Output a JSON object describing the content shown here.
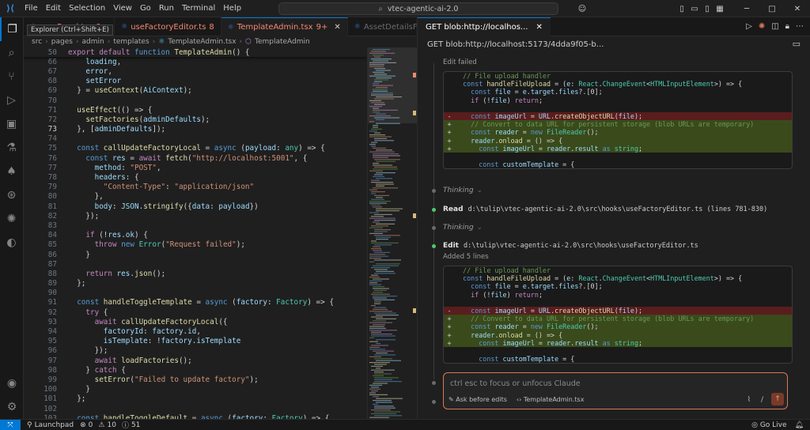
{
  "titlebar": {
    "menu": [
      "File",
      "Edit",
      "Selection",
      "View",
      "Go",
      "Run",
      "Terminal",
      "Help"
    ],
    "command_center": "vtec-agentic-ai-2.0"
  },
  "tooltip": "Explorer (Ctrl+Shift+E)",
  "tabs": [
    {
      "label": "cessPanel.tsx",
      "badge": "9+",
      "style": "red"
    },
    {
      "label": "useFactoryEditor.ts",
      "badge": "8",
      "style": "red"
    },
    {
      "label": "TemplateAdmin.tsx",
      "badge": "9+",
      "style": "active"
    },
    {
      "label": "AssetDetailsF",
      "badge": "",
      "style": "muted"
    }
  ],
  "breadcrumb": [
    "src",
    "pages",
    "admin",
    "templates",
    "TemplateAdmin.tsx",
    "TemplateAdmin"
  ],
  "editor": {
    "current_line": "73",
    "lines": [
      {
        "n": "50",
        "t": [
          [
            "kw2",
            "export "
          ],
          [
            "kw2",
            "default "
          ],
          [
            "kw",
            "function "
          ],
          [
            "fn",
            "TemplateAdmin"
          ],
          [
            "code",
            "() {"
          ]
        ],
        "sticky": true
      },
      {
        "n": "66",
        "t": [
          [
            "code",
            "    "
          ],
          [
            "var",
            "loading"
          ],
          [
            "code",
            ","
          ]
        ]
      },
      {
        "n": "67",
        "t": [
          [
            "code",
            "    "
          ],
          [
            "var",
            "error"
          ],
          [
            "code",
            ","
          ]
        ]
      },
      {
        "n": "68",
        "t": [
          [
            "code",
            "    "
          ],
          [
            "var",
            "setError"
          ]
        ]
      },
      {
        "n": "69",
        "t": [
          [
            "code",
            "  } = "
          ],
          [
            "fn",
            "useContext"
          ],
          [
            "code",
            "("
          ],
          [
            "var",
            "AiContext"
          ],
          [
            "code",
            ");"
          ]
        ]
      },
      {
        "n": "70",
        "t": []
      },
      {
        "n": "71",
        "t": [
          [
            "code",
            "  "
          ],
          [
            "fn",
            "useEffect"
          ],
          [
            "code",
            "(() => {"
          ]
        ]
      },
      {
        "n": "72",
        "t": [
          [
            "code",
            "    "
          ],
          [
            "fn",
            "setFactories"
          ],
          [
            "code",
            "("
          ],
          [
            "var",
            "adminDefaults"
          ],
          [
            "code",
            ");"
          ]
        ]
      },
      {
        "n": "73",
        "t": [
          [
            "code",
            "  }, ["
          ],
          [
            "var",
            "adminDefaults"
          ],
          [
            "code",
            "]);"
          ]
        ]
      },
      {
        "n": "74",
        "t": []
      },
      {
        "n": "75",
        "t": [
          [
            "code",
            "  "
          ],
          [
            "kw",
            "const "
          ],
          [
            "fn",
            "callUpdateFactoryLocal"
          ],
          [
            "code",
            " = "
          ],
          [
            "kw",
            "async "
          ],
          [
            "code",
            "("
          ],
          [
            "var",
            "payload"
          ],
          [
            "code",
            ": "
          ],
          [
            "type",
            "any"
          ],
          [
            "code",
            ") => {"
          ]
        ]
      },
      {
        "n": "76",
        "t": [
          [
            "code",
            "    "
          ],
          [
            "kw",
            "const "
          ],
          [
            "var",
            "res"
          ],
          [
            "code",
            " = "
          ],
          [
            "kw2",
            "await "
          ],
          [
            "fn",
            "fetch"
          ],
          [
            "code",
            "("
          ],
          [
            "str",
            "\"http://localhost:5001\""
          ],
          [
            "code",
            ", {"
          ]
        ]
      },
      {
        "n": "77",
        "t": [
          [
            "code",
            "      "
          ],
          [
            "var",
            "method"
          ],
          [
            "code",
            ": "
          ],
          [
            "str",
            "\"POST\""
          ],
          [
            "code",
            ","
          ]
        ]
      },
      {
        "n": "78",
        "t": [
          [
            "code",
            "      "
          ],
          [
            "var",
            "headers"
          ],
          [
            "code",
            ": {"
          ]
        ]
      },
      {
        "n": "79",
        "t": [
          [
            "code",
            "        "
          ],
          [
            "str",
            "\"Content-Type\""
          ],
          [
            "code",
            ": "
          ],
          [
            "str",
            "\"application/json\""
          ]
        ]
      },
      {
        "n": "80",
        "t": [
          [
            "code",
            "      },"
          ]
        ]
      },
      {
        "n": "81",
        "t": [
          [
            "code",
            "      "
          ],
          [
            "var",
            "body"
          ],
          [
            "code",
            ": "
          ],
          [
            "var",
            "JSON"
          ],
          [
            "code",
            "."
          ],
          [
            "fn",
            "stringify"
          ],
          [
            "code",
            "({"
          ],
          [
            "var",
            "data"
          ],
          [
            "code",
            ": "
          ],
          [
            "var",
            "payload"
          ],
          [
            "code",
            "})"
          ]
        ]
      },
      {
        "n": "82",
        "t": [
          [
            "code",
            "    });"
          ]
        ]
      },
      {
        "n": "83",
        "t": []
      },
      {
        "n": "84",
        "t": [
          [
            "code",
            "    "
          ],
          [
            "kw2",
            "if "
          ],
          [
            "code",
            "(!"
          ],
          [
            "var",
            "res"
          ],
          [
            "code",
            "."
          ],
          [
            "var",
            "ok"
          ],
          [
            "code",
            ") {"
          ]
        ]
      },
      {
        "n": "85",
        "t": [
          [
            "code",
            "      "
          ],
          [
            "kw2",
            "throw "
          ],
          [
            "kw",
            "new "
          ],
          [
            "type",
            "Error"
          ],
          [
            "code",
            "("
          ],
          [
            "str",
            "\"Request failed\""
          ],
          [
            "code",
            ");"
          ]
        ]
      },
      {
        "n": "86",
        "t": [
          [
            "code",
            "    }"
          ]
        ]
      },
      {
        "n": "87",
        "t": []
      },
      {
        "n": "88",
        "t": [
          [
            "code",
            "    "
          ],
          [
            "kw2",
            "return "
          ],
          [
            "var",
            "res"
          ],
          [
            "code",
            "."
          ],
          [
            "fn",
            "json"
          ],
          [
            "code",
            "();"
          ]
        ]
      },
      {
        "n": "89",
        "t": [
          [
            "code",
            "  };"
          ]
        ]
      },
      {
        "n": "90",
        "t": []
      },
      {
        "n": "91",
        "t": [
          [
            "code",
            "  "
          ],
          [
            "kw",
            "const "
          ],
          [
            "fn",
            "handleToggleTemplate"
          ],
          [
            "code",
            " = "
          ],
          [
            "kw",
            "async "
          ],
          [
            "code",
            "("
          ],
          [
            "var",
            "factory"
          ],
          [
            "code",
            ": "
          ],
          [
            "type",
            "Factory"
          ],
          [
            "code",
            ") => {"
          ]
        ]
      },
      {
        "n": "92",
        "t": [
          [
            "code",
            "    "
          ],
          [
            "kw2",
            "try "
          ],
          [
            "code",
            "{"
          ]
        ]
      },
      {
        "n": "93",
        "t": [
          [
            "code",
            "      "
          ],
          [
            "kw2",
            "await "
          ],
          [
            "fn",
            "callUpdateFactoryLocal"
          ],
          [
            "code",
            "({"
          ]
        ]
      },
      {
        "n": "94",
        "t": [
          [
            "code",
            "        "
          ],
          [
            "var",
            "factoryId"
          ],
          [
            "code",
            ": "
          ],
          [
            "var",
            "factory"
          ],
          [
            "code",
            "."
          ],
          [
            "var",
            "id"
          ],
          [
            "code",
            ","
          ]
        ]
      },
      {
        "n": "95",
        "t": [
          [
            "code",
            "        "
          ],
          [
            "var",
            "isTemplate"
          ],
          [
            "code",
            ": !"
          ],
          [
            "var",
            "factory"
          ],
          [
            "code",
            "."
          ],
          [
            "var",
            "isTemplate"
          ]
        ]
      },
      {
        "n": "96",
        "t": [
          [
            "code",
            "      });"
          ]
        ]
      },
      {
        "n": "97",
        "t": [
          [
            "code",
            "      "
          ],
          [
            "kw2",
            "await "
          ],
          [
            "fn",
            "loadFactories"
          ],
          [
            "code",
            "();"
          ]
        ]
      },
      {
        "n": "98",
        "t": [
          [
            "code",
            "    } "
          ],
          [
            "kw2",
            "catch "
          ],
          [
            "code",
            "{"
          ]
        ]
      },
      {
        "n": "99",
        "t": [
          [
            "code",
            "      "
          ],
          [
            "fn",
            "setError"
          ],
          [
            "code",
            "("
          ],
          [
            "str",
            "\"Failed to update factory\""
          ],
          [
            "code",
            ");"
          ]
        ]
      },
      {
        "n": "100",
        "t": [
          [
            "code",
            "    }"
          ]
        ]
      },
      {
        "n": "101",
        "t": [
          [
            "code",
            "  };"
          ]
        ]
      },
      {
        "n": "102",
        "t": []
      },
      {
        "n": "103",
        "t": [
          [
            "code",
            "  "
          ],
          [
            "kw",
            "const "
          ],
          [
            "fn",
            "handleToggleDefault"
          ],
          [
            "code",
            " = "
          ],
          [
            "kw",
            "async "
          ],
          [
            "code",
            "("
          ],
          [
            "var",
            "factory"
          ],
          [
            "code",
            ": "
          ],
          [
            "type",
            "Factory"
          ],
          [
            "code",
            ") => {"
          ]
        ]
      }
    ]
  },
  "panel": {
    "tab_label": "GET blob:http://localhos...",
    "title": "GET blob:http://localhost:5173/4dda9f05-b...",
    "edit_failed": "Edit failed",
    "diff": [
      {
        "k": "ctx",
        "t": [
          [
            "cm",
            "  // File upload handler"
          ]
        ]
      },
      {
        "k": "ctx",
        "t": [
          [
            "code",
            "  "
          ],
          [
            "kw",
            "const "
          ],
          [
            "fn",
            "handleFileUpload"
          ],
          [
            "code",
            " = ("
          ],
          [
            "var",
            "e"
          ],
          [
            "code",
            ": "
          ],
          [
            "type",
            "React"
          ],
          [
            "code",
            "."
          ],
          [
            "type",
            "ChangeEvent"
          ],
          [
            "code",
            "<"
          ],
          [
            "type",
            "HTMLInputElement"
          ],
          [
            "code",
            ">) => {"
          ]
        ]
      },
      {
        "k": "ctx",
        "t": [
          [
            "code",
            "    "
          ],
          [
            "kw",
            "const "
          ],
          [
            "var",
            "file"
          ],
          [
            "code",
            " = "
          ],
          [
            "var",
            "e"
          ],
          [
            "code",
            "."
          ],
          [
            "var",
            "target"
          ],
          [
            "code",
            "."
          ],
          [
            "var",
            "files"
          ],
          [
            "code",
            "?.[0];"
          ]
        ]
      },
      {
        "k": "ctx",
        "t": [
          [
            "code",
            "    "
          ],
          [
            "kw2",
            "if "
          ],
          [
            "code",
            "(!"
          ],
          [
            "var",
            "file"
          ],
          [
            "code",
            ") "
          ],
          [
            "kw2",
            "return"
          ],
          [
            "code",
            ";"
          ]
        ]
      },
      {
        "k": "ctx",
        "t": []
      },
      {
        "k": "del",
        "t": [
          [
            "code",
            "    "
          ],
          [
            "kw",
            "const "
          ],
          [
            "var",
            "imageUrl"
          ],
          [
            "code",
            " = "
          ],
          [
            "var",
            "URL"
          ],
          [
            "code",
            "."
          ],
          [
            "fn",
            "createObjectURL"
          ],
          [
            "code",
            "("
          ],
          [
            "var",
            "file"
          ],
          [
            "code",
            ");"
          ]
        ]
      },
      {
        "k": "add",
        "t": [
          [
            "cm",
            "    // Convert to data URL for persistent storage (blob URLs are temporary)"
          ]
        ]
      },
      {
        "k": "add",
        "t": [
          [
            "code",
            "    "
          ],
          [
            "kw",
            "const "
          ],
          [
            "var",
            "reader"
          ],
          [
            "code",
            " = "
          ],
          [
            "kw",
            "new "
          ],
          [
            "type",
            "FileReader"
          ],
          [
            "code",
            "();"
          ]
        ]
      },
      {
        "k": "add",
        "t": [
          [
            "code",
            "    "
          ],
          [
            "var",
            "reader"
          ],
          [
            "code",
            "."
          ],
          [
            "fn",
            "onload"
          ],
          [
            "code",
            " = () => {"
          ]
        ]
      },
      {
        "k": "add",
        "t": [
          [
            "code",
            "      "
          ],
          [
            "kw",
            "const "
          ],
          [
            "var",
            "imageUrl"
          ],
          [
            "code",
            " = "
          ],
          [
            "var",
            "reader"
          ],
          [
            "code",
            "."
          ],
          [
            "var",
            "result"
          ],
          [
            "kw",
            " as "
          ],
          [
            "type",
            "string"
          ],
          [
            "code",
            ";"
          ]
        ]
      },
      {
        "k": "ctx",
        "t": []
      },
      {
        "k": "ctx",
        "t": [
          [
            "code",
            "      "
          ],
          [
            "kw",
            "const "
          ],
          [
            "var",
            "customTemplate"
          ],
          [
            "code",
            " = {"
          ]
        ]
      }
    ],
    "thinking": "Thinking",
    "read": {
      "label": "Read",
      "path": "d:\\tulip\\vtec-agentic-ai-2.0\\src\\hooks\\useFactoryEditor.ts (lines 781-830)"
    },
    "edit": {
      "label": "Edit",
      "path": "d:\\tulip\\vtec-agentic-ai-2.0\\src\\hooks\\useFactoryEditor.ts",
      "note": "Added 5 lines"
    },
    "input_placeholder": "ctrl esc to focus or unfocus Claude",
    "ask_before_edits": "Ask before edits",
    "context_file": "TemplateAdmin.tsx"
  },
  "statusbar": {
    "launchpad": "Launchpad",
    "errors": "0",
    "warnings": "10",
    "info": "51",
    "golive": "Go Live"
  },
  "colors": {
    "accent": "#0078d4",
    "claude": "#d97757",
    "add_bg": "#3a4a1b",
    "del_bg": "#5a1d1d"
  }
}
